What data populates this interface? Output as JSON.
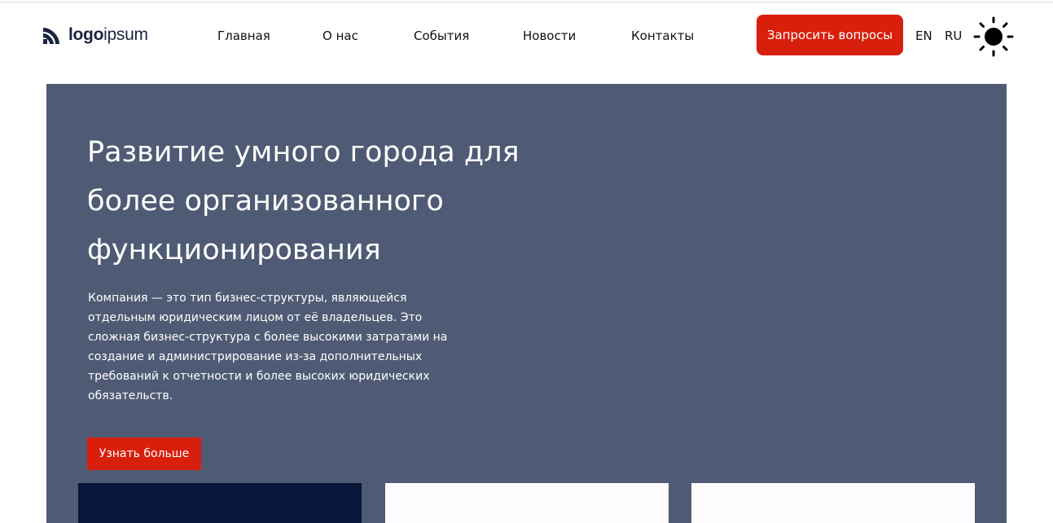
{
  "logo": {
    "text_bold": "logo",
    "text_light": "ipsum",
    "icon": "logo-mark-icon"
  },
  "nav": {
    "items": [
      {
        "label": "Главная"
      },
      {
        "label": "О нас"
      },
      {
        "label": "События"
      },
      {
        "label": "Новости"
      },
      {
        "label": "Контакты"
      }
    ]
  },
  "header": {
    "cta_label": "Запросить вопросы",
    "lang_en": "EN",
    "lang_ru": "RU",
    "theme_icon": "sun-icon"
  },
  "hero": {
    "title": "Развитие умного города для более организованного функционирования",
    "description": "Компания — это тип бизнес-структуры, являющейся отдельным юридическим лицом от её владельцев. Это сложная бизнес-структура с более высокими затратами на создание и администрирование из-за дополнительных требований к отчетности и более высоких юридических обязательств.",
    "button_label": "Узнать больше"
  },
  "colors": {
    "accent": "#d81f0c",
    "hero_bg": "#4f5b74",
    "dark_card": "#06173a",
    "light_card": "#fdfbfd"
  }
}
